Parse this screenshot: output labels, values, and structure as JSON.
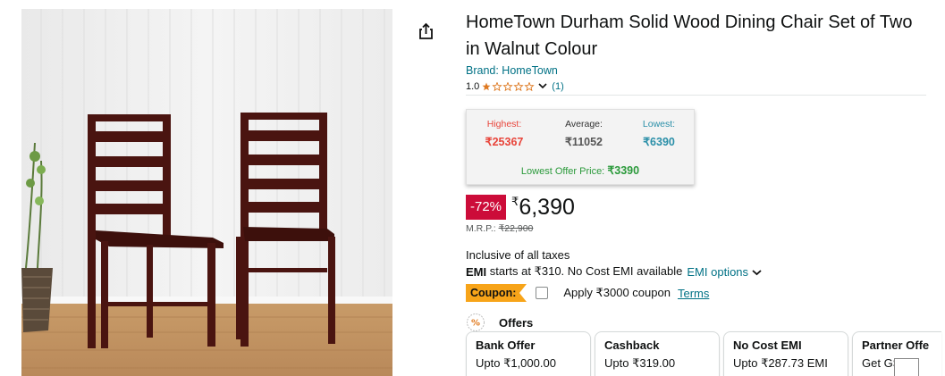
{
  "product": {
    "title": "HomeTown Durham Solid Wood Dining Chair Set of Two in Walnut Colour",
    "brand": "Brand: HomeTown",
    "rating_value": "1.0",
    "rating_count": "(1)",
    "rating_stars": 1
  },
  "price_history": {
    "highest_label": "Highest:",
    "highest_value": "₹25367",
    "average_label": "Average:",
    "average_value": "₹11052",
    "lowest_label": "Lowest:",
    "lowest_value": "₹6390",
    "lowest_offer_label": "Lowest Offer Price:",
    "lowest_offer_value": "₹3390",
    "colors": {
      "highest": "#e8443a",
      "average": "#555555",
      "lowest": "#2a8fa8",
      "offer": "#2b9a3b"
    }
  },
  "pricing": {
    "discount": "-72%",
    "currency_symbol": "₹",
    "price": "6,390",
    "mrp_label": "M.R.P.:",
    "mrp_value": "₹22,900",
    "taxes": "Inclusive of all taxes",
    "emi_bold": "EMI",
    "emi_text": " starts at ₹310. No Cost EMI available",
    "emi_link": "EMI options"
  },
  "coupon": {
    "badge": "Coupon:",
    "text": "Apply ₹3000 coupon",
    "terms": "Terms"
  },
  "offers": {
    "heading": "Offers",
    "cards": [
      {
        "title": "Bank Offer",
        "desc": "Upto ₹1,000.00"
      },
      {
        "title": "Cashback",
        "desc": "Upto ₹319.00"
      },
      {
        "title": "No Cost EMI",
        "desc": "Upto ₹287.73 EMI"
      },
      {
        "title": "Partner Offe",
        "desc": "Get GST"
      }
    ]
  },
  "icons": {
    "share": "share-icon",
    "offers": "offers-percent-icon",
    "chevron": "chevron-down-icon"
  }
}
